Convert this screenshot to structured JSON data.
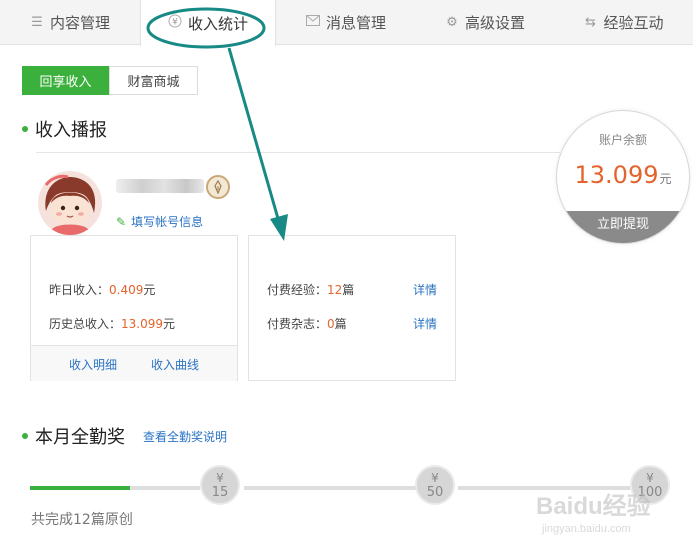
{
  "tabs": [
    {
      "label": "内容管理",
      "icon": "list-icon"
    },
    {
      "label": "收入统计",
      "icon": "yen-icon"
    },
    {
      "label": "消息管理",
      "icon": "mail-icon"
    },
    {
      "label": "高级设置",
      "icon": "gear-icon"
    },
    {
      "label": "经验互动",
      "icon": "swap-icon"
    }
  ],
  "subtabs": [
    "回享收入",
    "财富商城"
  ],
  "broadcast": {
    "title": "收入播报"
  },
  "profile": {
    "edit_label": "填写帐号信息"
  },
  "balance": {
    "label": "账户余额",
    "value": "13.099",
    "unit": "元",
    "withdraw": "立即提现"
  },
  "income": {
    "yesterday_label": "昨日收入：",
    "yesterday_value": "0.409",
    "yesterday_unit": "元",
    "total_label": "历史总收入：",
    "total_value": "13.099",
    "total_unit": "元",
    "detail_link": "收入明细",
    "curve_link": "收入曲线"
  },
  "paid": {
    "exp_label": "付费经验：",
    "exp_count": "12",
    "exp_unit": "篇",
    "mag_label": "付费杂志：",
    "mag_count": "0",
    "mag_unit": "篇",
    "detail": "详情"
  },
  "attendance": {
    "title": "本月全勤奖",
    "link": "查看全勤奖说明",
    "milestones": [
      {
        "symbol": "¥",
        "value": "15"
      },
      {
        "symbol": "¥",
        "value": "50"
      },
      {
        "symbol": "¥",
        "value": "100"
      }
    ],
    "progress_count": 12,
    "complete_text": "共完成12篇原创"
  },
  "watermark": {
    "text": "Baidu经验",
    "sub": "jingyan.baidu.com"
  },
  "colors": {
    "accent_green": "#3cb03c",
    "amount_orange": "#e4632c",
    "link_blue": "#2a73c4",
    "annotation_teal": "#178a86"
  }
}
